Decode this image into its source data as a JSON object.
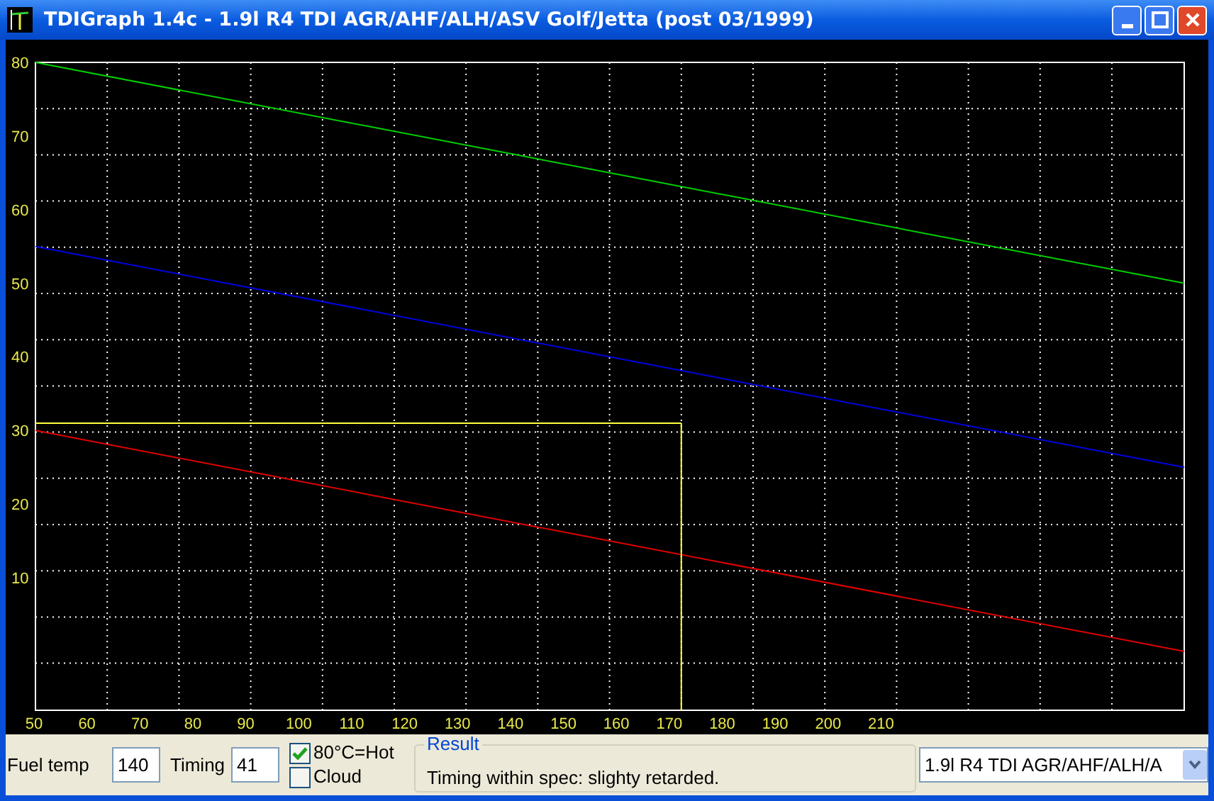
{
  "window": {
    "title": "TDIGraph 1.4c - 1.9l R4 TDI AGR/AHF/ALH/ASV Golf/Jetta (post 03/1999)"
  },
  "chart": {
    "chart_data": {
      "type": "line",
      "x": [
        50,
        267
      ],
      "xlim": [
        50,
        267
      ],
      "ylim": [
        -8,
        80
      ],
      "xticks": [
        50,
        60,
        70,
        80,
        90,
        100,
        110,
        120,
        130,
        140,
        150,
        160,
        170,
        180,
        190,
        200,
        210
      ],
      "yticks": [
        10,
        20,
        30,
        40,
        50,
        60,
        70,
        80
      ],
      "series": [
        {
          "color": "#00d000",
          "values": [
            80,
            50
          ]
        },
        {
          "color": "#0000e0",
          "values": [
            55,
            25
          ]
        },
        {
          "color": "#e00000",
          "values": [
            30,
            0
          ]
        }
      ],
      "ref_lines": [
        {
          "axis": "y",
          "value": 31,
          "color": "#ffff40"
        },
        {
          "axis": "x",
          "value": 172,
          "color": "#ffff40"
        }
      ]
    }
  },
  "controls": {
    "fuel_temp": {
      "label": "Fuel temp",
      "value": "140"
    },
    "timing": {
      "label": "Timing",
      "value": "41"
    },
    "checkboxes": [
      {
        "label": "80°C=Hot",
        "checked": true
      },
      {
        "label": "Cloud",
        "checked": false
      }
    ],
    "result": {
      "title": "Result",
      "text": "Timing within spec: slighty retarded."
    },
    "engine_select": {
      "value": "1.9l R4 TDI AGR/AHF/ALH/A"
    }
  }
}
